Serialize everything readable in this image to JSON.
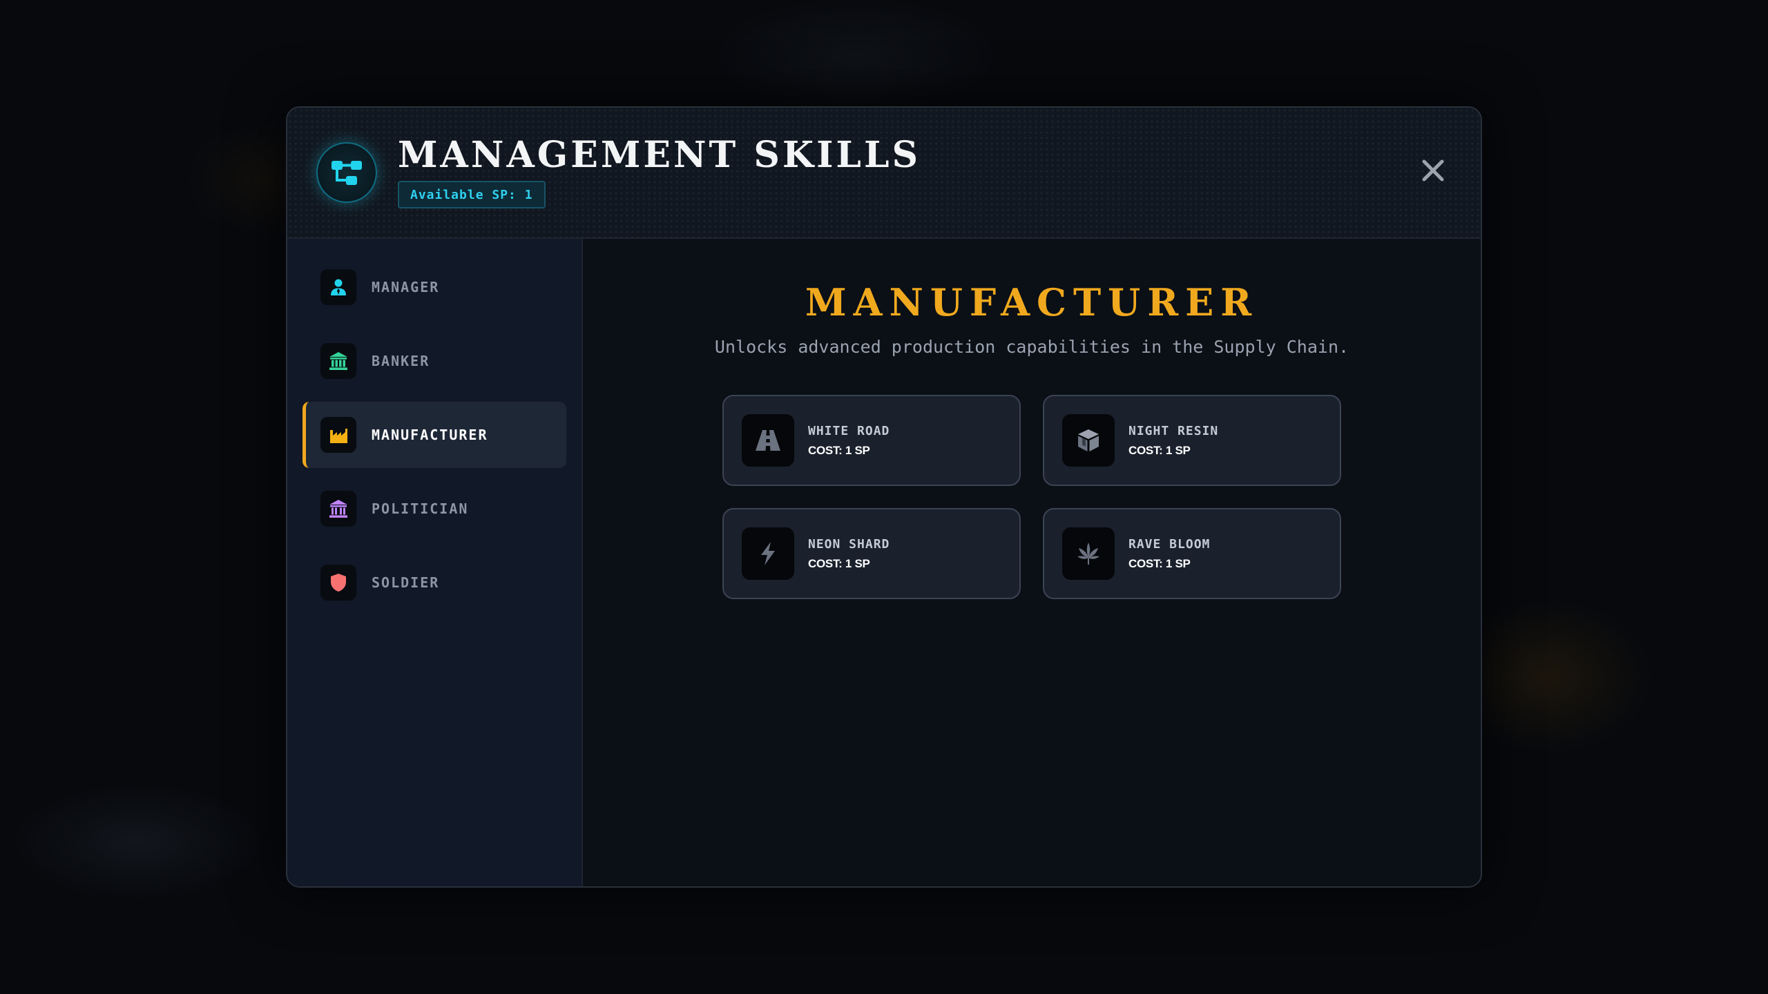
{
  "dialog": {
    "title": "MANAGEMENT SKILLS",
    "available_sp": "Available SP: 1",
    "emblem_icon": "skill-tree-icon",
    "close_icon": "close-icon"
  },
  "sidebar": {
    "items": [
      {
        "label": "MANAGER",
        "icon": "person-icon",
        "color": "#22d3ee",
        "active": false
      },
      {
        "label": "BANKER",
        "icon": "bank-icon",
        "color": "#34d399",
        "active": false
      },
      {
        "label": "MANUFACTURER",
        "icon": "factory-icon",
        "color": "#f5b014",
        "active": true
      },
      {
        "label": "POLITICIAN",
        "icon": "government-building-icon",
        "color": "#c084fc",
        "active": false
      },
      {
        "label": "SOLDIER",
        "icon": "shield-icon",
        "color": "#f87171",
        "active": false
      }
    ]
  },
  "main": {
    "title": "MANUFACTURER",
    "description": "Unlocks advanced production capabilities in the Supply Chain.",
    "skills": [
      {
        "name": "WHITE ROAD",
        "cost": "COST: 1 SP",
        "icon": "road-icon"
      },
      {
        "name": "NIGHT RESIN",
        "cost": "COST: 1 SP",
        "icon": "cube-icon"
      },
      {
        "name": "NEON SHARD",
        "cost": "COST: 1 SP",
        "icon": "lightning-icon"
      },
      {
        "name": "RAVE BLOOM",
        "cost": "COST: 1 SP",
        "icon": "leaf-icon"
      }
    ]
  },
  "colors": {
    "accent": "#f0a91e",
    "cyan": "#22d3ee",
    "panel": "#0b0f16",
    "sidebar": "#111827"
  }
}
